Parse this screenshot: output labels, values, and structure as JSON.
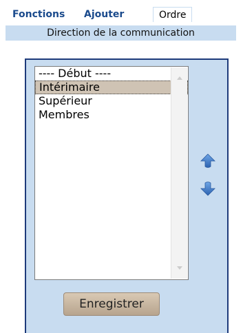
{
  "tabs": [
    {
      "label": "Fonctions",
      "active": false
    },
    {
      "label": "Ajouter",
      "active": false
    },
    {
      "label": "Ordre",
      "active": true
    }
  ],
  "subtitle": "Direction de la communication",
  "order_list": {
    "items": [
      "---- Début ----",
      "Intérimaire",
      "Supérieur",
      "Membres"
    ],
    "selected": "Intérimaire"
  },
  "icons": {
    "move_up": "arrow-up-icon",
    "move_down": "arrow-down-icon"
  },
  "save_label": "Enregistrer",
  "colors": {
    "tab_link": "#1a4a8c",
    "panel_bg": "#c8dcf0",
    "panel_border": "#1d3a7a",
    "selection_bg": "#cfc3b4",
    "arrow": "#3b74c6",
    "save_button": "#c9b8a2"
  }
}
